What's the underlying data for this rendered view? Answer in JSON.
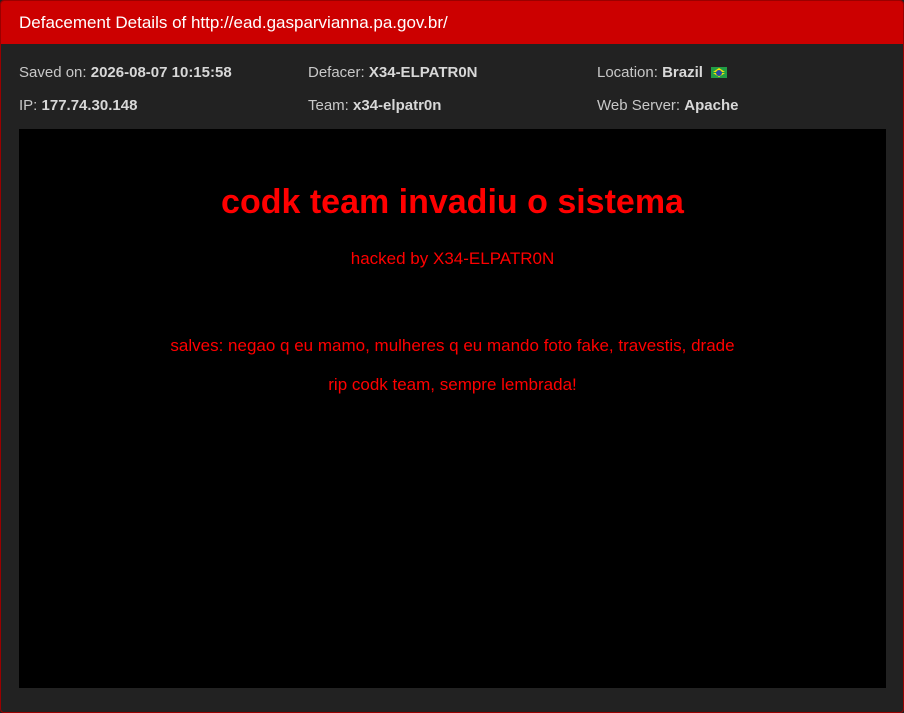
{
  "header": {
    "title": "Defacement Details of http://ead.gasparvianna.pa.gov.br/"
  },
  "details": {
    "saved_label": "Saved on:",
    "saved_value": "2026-08-07 10:15:58",
    "defacer_label": "Defacer:",
    "defacer_value": "X34-ELPATR0N",
    "location_label": "Location:",
    "location_value": "Brazil",
    "location_flag": "brazil-flag-icon",
    "ip_label": "IP:",
    "ip_value": "177.74.30.148",
    "team_label": "Team:",
    "team_value": "x34-elpatr0n",
    "server_label": "Web Server:",
    "server_value": "Apache"
  },
  "mirror": {
    "title": "codk team invadiu o sistema",
    "hacked_by": "hacked by X34-ELPATR0N",
    "salves": "salves: negao q eu mamo, mulheres q eu mando foto fake, travestis, drade",
    "rip": "rip codk team, sempre lembrada!"
  },
  "colors": {
    "header_bg": "#cc0000",
    "panel_bg": "#222222",
    "mirror_bg": "#000000",
    "mirror_text": "#ff0000"
  }
}
